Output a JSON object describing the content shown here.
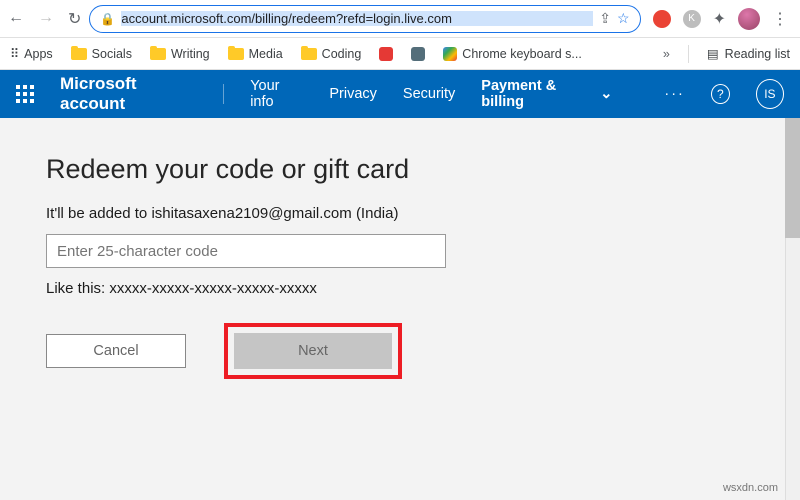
{
  "browser": {
    "url": "account.microsoft.com/billing/redeem?refd=login.live.com",
    "bookmarks": {
      "apps": "Apps",
      "socials": "Socials",
      "writing": "Writing",
      "media": "Media",
      "coding": "Coding",
      "chrome_kb": "Chrome keyboard s...",
      "reading_list": "Reading list"
    }
  },
  "nav": {
    "brand": "Microsoft account",
    "your_info": "Your info",
    "privacy": "Privacy",
    "security": "Security",
    "payment": "Payment & billing",
    "more": "···",
    "help": "?",
    "avatar": "IS"
  },
  "page": {
    "heading": "Redeem your code or gift card",
    "subtitle": "It'll be added to ishitasaxena2109@gmail.com (India)",
    "placeholder": "Enter 25-character code",
    "hint": "Like this: xxxxx-xxxxx-xxxxx-xxxxx-xxxxx",
    "cancel": "Cancel",
    "next": "Next"
  },
  "watermark": "wsxdn.com"
}
